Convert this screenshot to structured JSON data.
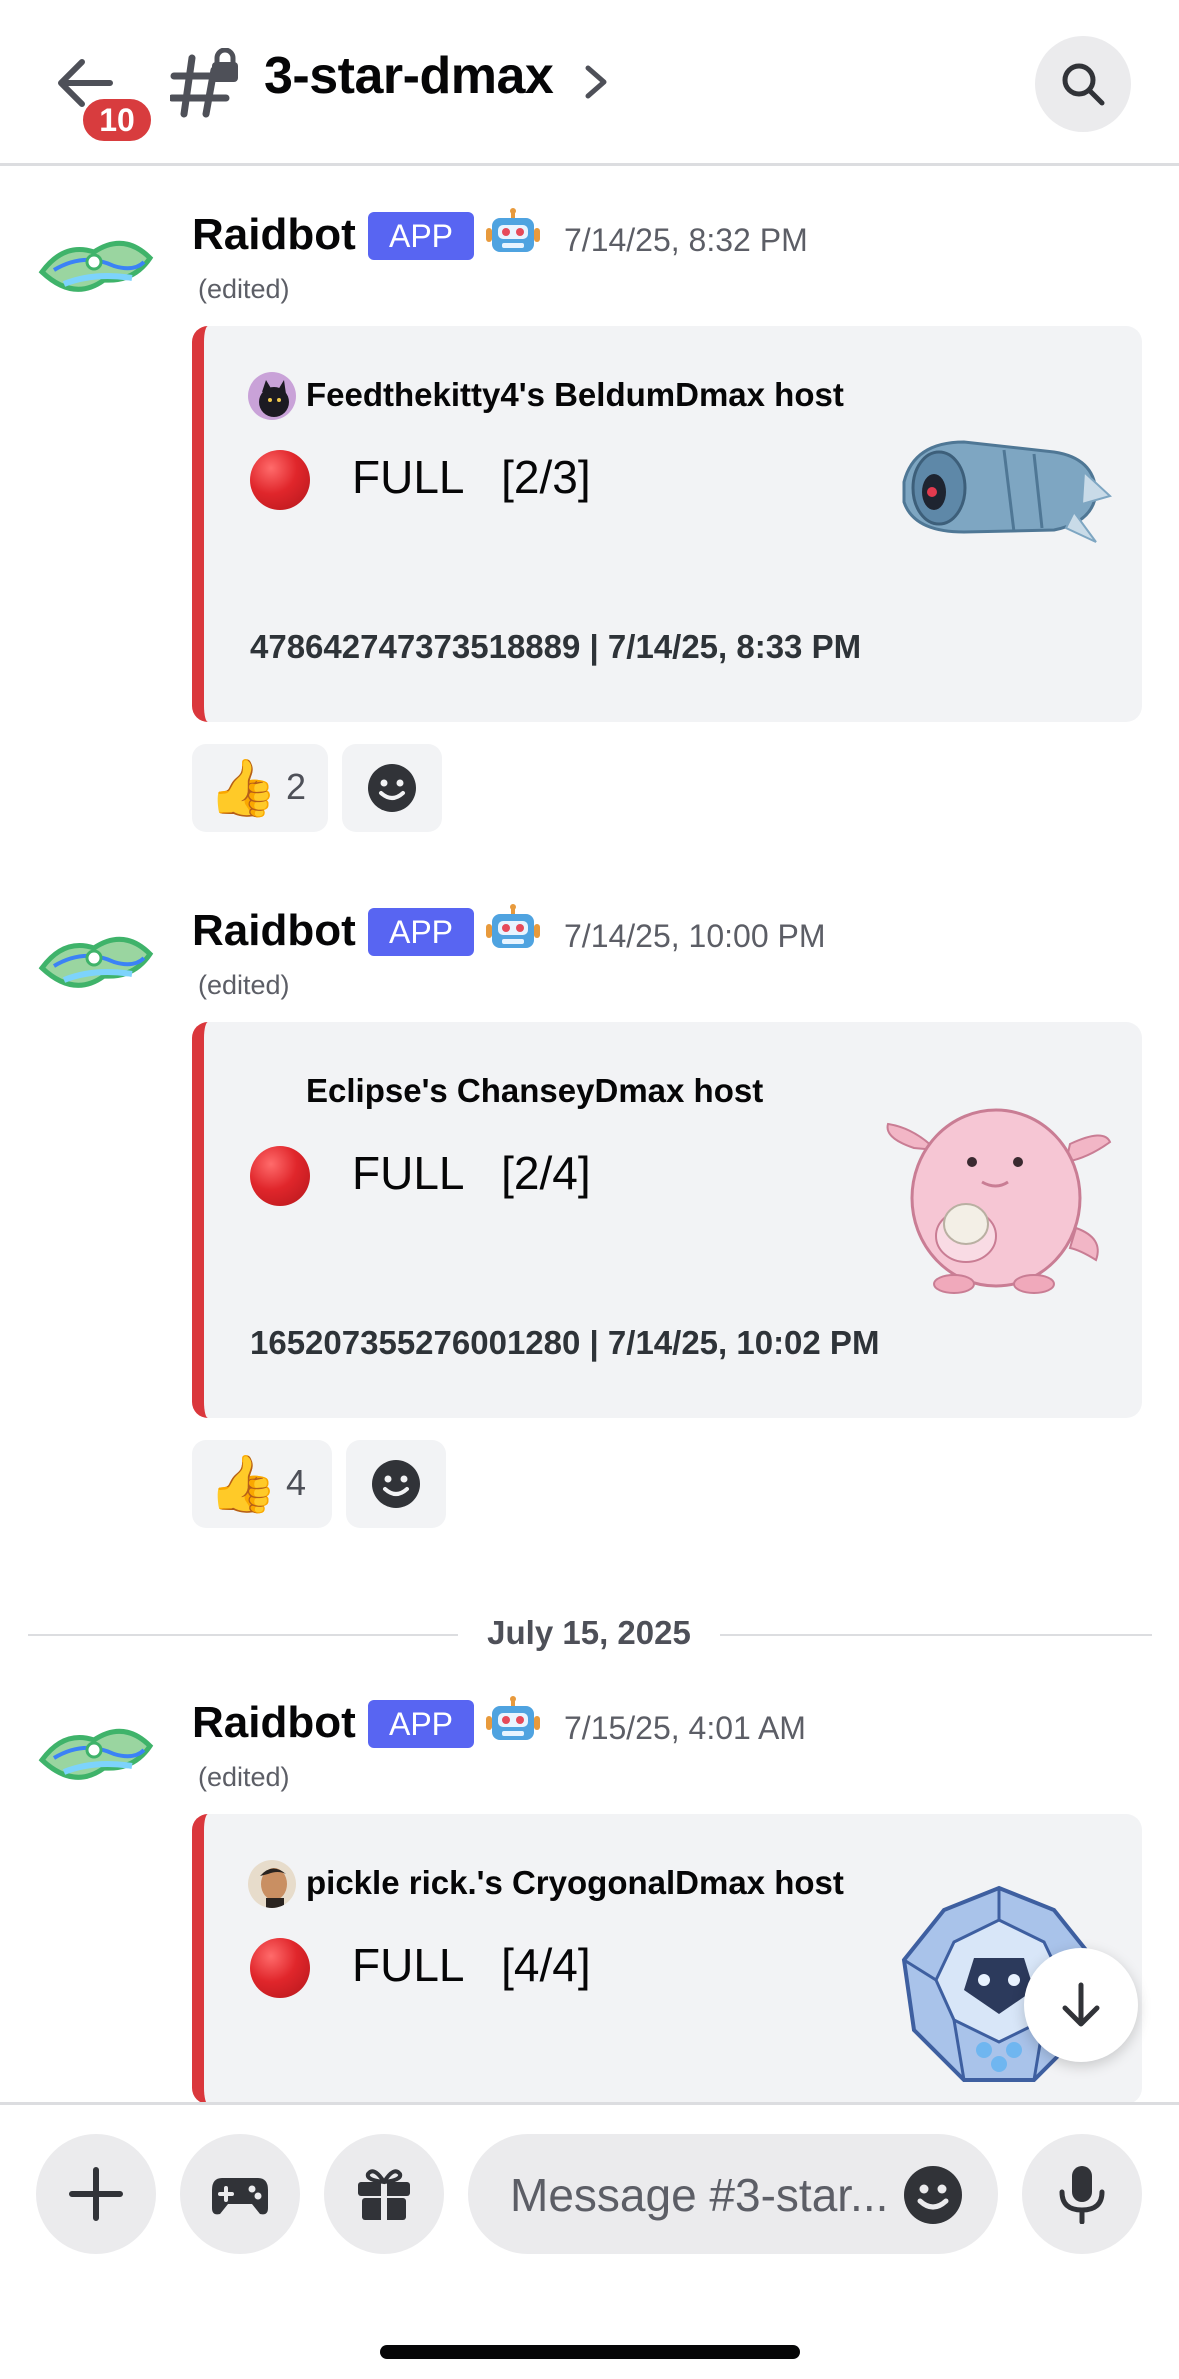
{
  "header": {
    "unread_count": "10",
    "channel_name": "3-star-dmax"
  },
  "messages": [
    {
      "author": "Raidbot",
      "tag": "APP",
      "timestamp": "7/14/25, 8:32 PM",
      "edited": "(edited)",
      "embed": {
        "author": "Feedthekitty4's BeldumDmax host",
        "status": "FULL   [2/3]",
        "footer": "478642747373518889 | 7/14/25, 8:33 PM",
        "thumbnail": "beldum"
      },
      "reaction": {
        "emoji": "👍",
        "count": "2"
      }
    },
    {
      "author": "Raidbot",
      "tag": "APP",
      "timestamp": "7/14/25, 10:00 PM",
      "edited": "(edited)",
      "embed": {
        "author": "Eclipse's ChanseyDmax host",
        "status": "FULL   [2/4]",
        "footer": "165207355276001280 | 7/14/25, 10:02 PM",
        "thumbnail": "chansey"
      },
      "reaction": {
        "emoji": "👍",
        "count": "4"
      }
    },
    {
      "author": "Raidbot",
      "tag": "APP",
      "timestamp": "7/15/25, 4:01 AM",
      "edited": "(edited)",
      "embed": {
        "author": "pickle rick.'s CryogonalDmax host",
        "status": "FULL   [4/4]",
        "thumbnail": "cryogonal"
      }
    }
  ],
  "date_divider": "July 15, 2025",
  "composer": {
    "placeholder": "Message #3-star..."
  },
  "colors": {
    "blurple": "#5865f2",
    "embed_bar": "#da373c",
    "embed_bg": "#f2f3f5",
    "badge": "#d83c3e"
  }
}
